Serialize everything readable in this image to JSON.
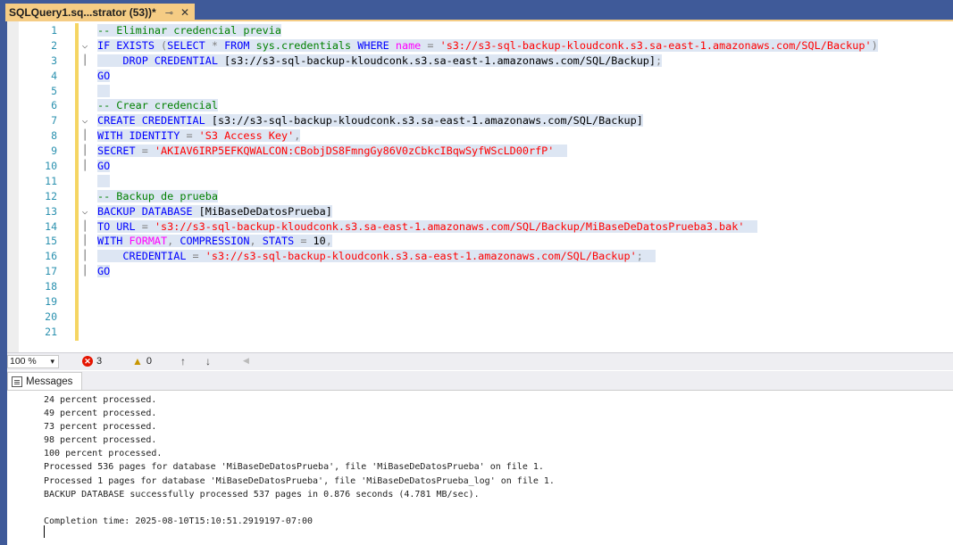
{
  "tab": {
    "title": "SQLQuery1.sq...strator (53))*",
    "pin_icon": "pin-icon",
    "close_icon": "close-icon"
  },
  "editor": {
    "line_numbers": [
      "1",
      "2",
      "3",
      "4",
      "5",
      "6",
      "7",
      "8",
      "9",
      "10",
      "11",
      "12",
      "13",
      "14",
      "15",
      "16",
      "17",
      "18",
      "19",
      "20",
      "21"
    ]
  },
  "code": {
    "l1_comment": "-- Eliminar credencial previa",
    "l2_if": "IF EXISTS",
    "l2_paren_open": " (",
    "l2_select": "SELECT",
    "l2_star": " * ",
    "l2_from": "FROM",
    "l2_sys": " sys.credentials ",
    "l2_where": "WHERE",
    "l2_name": " name ",
    "l2_eq": "=",
    "l2_str": " 's3://s3-sql-backup-kloudconk.s3.sa-east-1.amazonaws.com/SQL/Backup'",
    "l2_close": ")",
    "l3_drop": "    DROP CREDENTIAL",
    "l3_rest": " [s3://s3-sql-backup-kloudconk.s3.sa-east-1.amazonaws.com/SQL/Backup]",
    "l3_semi": ";",
    "l4_go": "GO",
    "l6_comment": "-- Crear credencial",
    "l7_create": "CREATE CREDENTIAL",
    "l7_rest": " [s3://s3-sql-backup-kloudconk.s3.sa-east-1.amazonaws.com/SQL/Backup]",
    "l8_with": "WITH IDENTITY",
    "l8_eq": " = ",
    "l8_str": "'S3 Access Key'",
    "l8_comma": ",",
    "l9_secret": "SECRET",
    "l9_eq": " = ",
    "l9_str": "'AKIAV6IRP5EFKQWALCON:CBobjDS8FmngGy86V0zCbkcIBqwSyfWScLD00rfP'",
    "l10_go": "GO",
    "l12_comment": "-- Backup de prueba",
    "l13_backup": "BACKUP DATABASE",
    "l13_rest": " [MiBaseDeDatosPrueba]",
    "l14_to": "TO URL",
    "l14_eq": " = ",
    "l14_str": "'s3://s3-sql-backup-kloudconk.s3.sa-east-1.amazonaws.com/SQL/Backup/MiBaseDeDatosPrueba3.bak'",
    "l15_with": "WITH",
    "l15_format": " FORMAT",
    "l15_c1": ", ",
    "l15_comp": "COMPRESSION",
    "l15_c2": ", ",
    "l15_stats": "STATS",
    "l15_eq": " = ",
    "l15_num": "10",
    "l15_c3": ",",
    "l16_cred": "    CREDENTIAL",
    "l16_eq": " = ",
    "l16_str": "'s3://s3-sql-backup-kloudconk.s3.sa-east-1.amazonaws.com/SQL/Backup'",
    "l16_semi": ";",
    "l17_go": "GO"
  },
  "status": {
    "zoom": "100 %",
    "error_count": "3",
    "warning_count": "0"
  },
  "messages_tab": {
    "label": "Messages"
  },
  "messages": [
    "24 percent processed.",
    "49 percent processed.",
    "73 percent processed.",
    "98 percent processed.",
    "100 percent processed.",
    "Processed 536 pages for database 'MiBaseDeDatosPrueba', file 'MiBaseDeDatosPrueba' on file 1.",
    "Processed 1 pages for database 'MiBaseDeDatosPrueba', file 'MiBaseDeDatosPrueba_log' on file 1.",
    "BACKUP DATABASE successfully processed 537 pages in 0.876 seconds (4.781 MB/sec).",
    "",
    "Completion time: 2025-08-10T15:10:51.2919197-07:00"
  ],
  "colors": {
    "frame": "#3f5a99",
    "tab_active": "#f5cc84",
    "keyword": "#0000ff",
    "string": "#ff0000",
    "comment": "#008000",
    "line_number": "#2b91af"
  }
}
